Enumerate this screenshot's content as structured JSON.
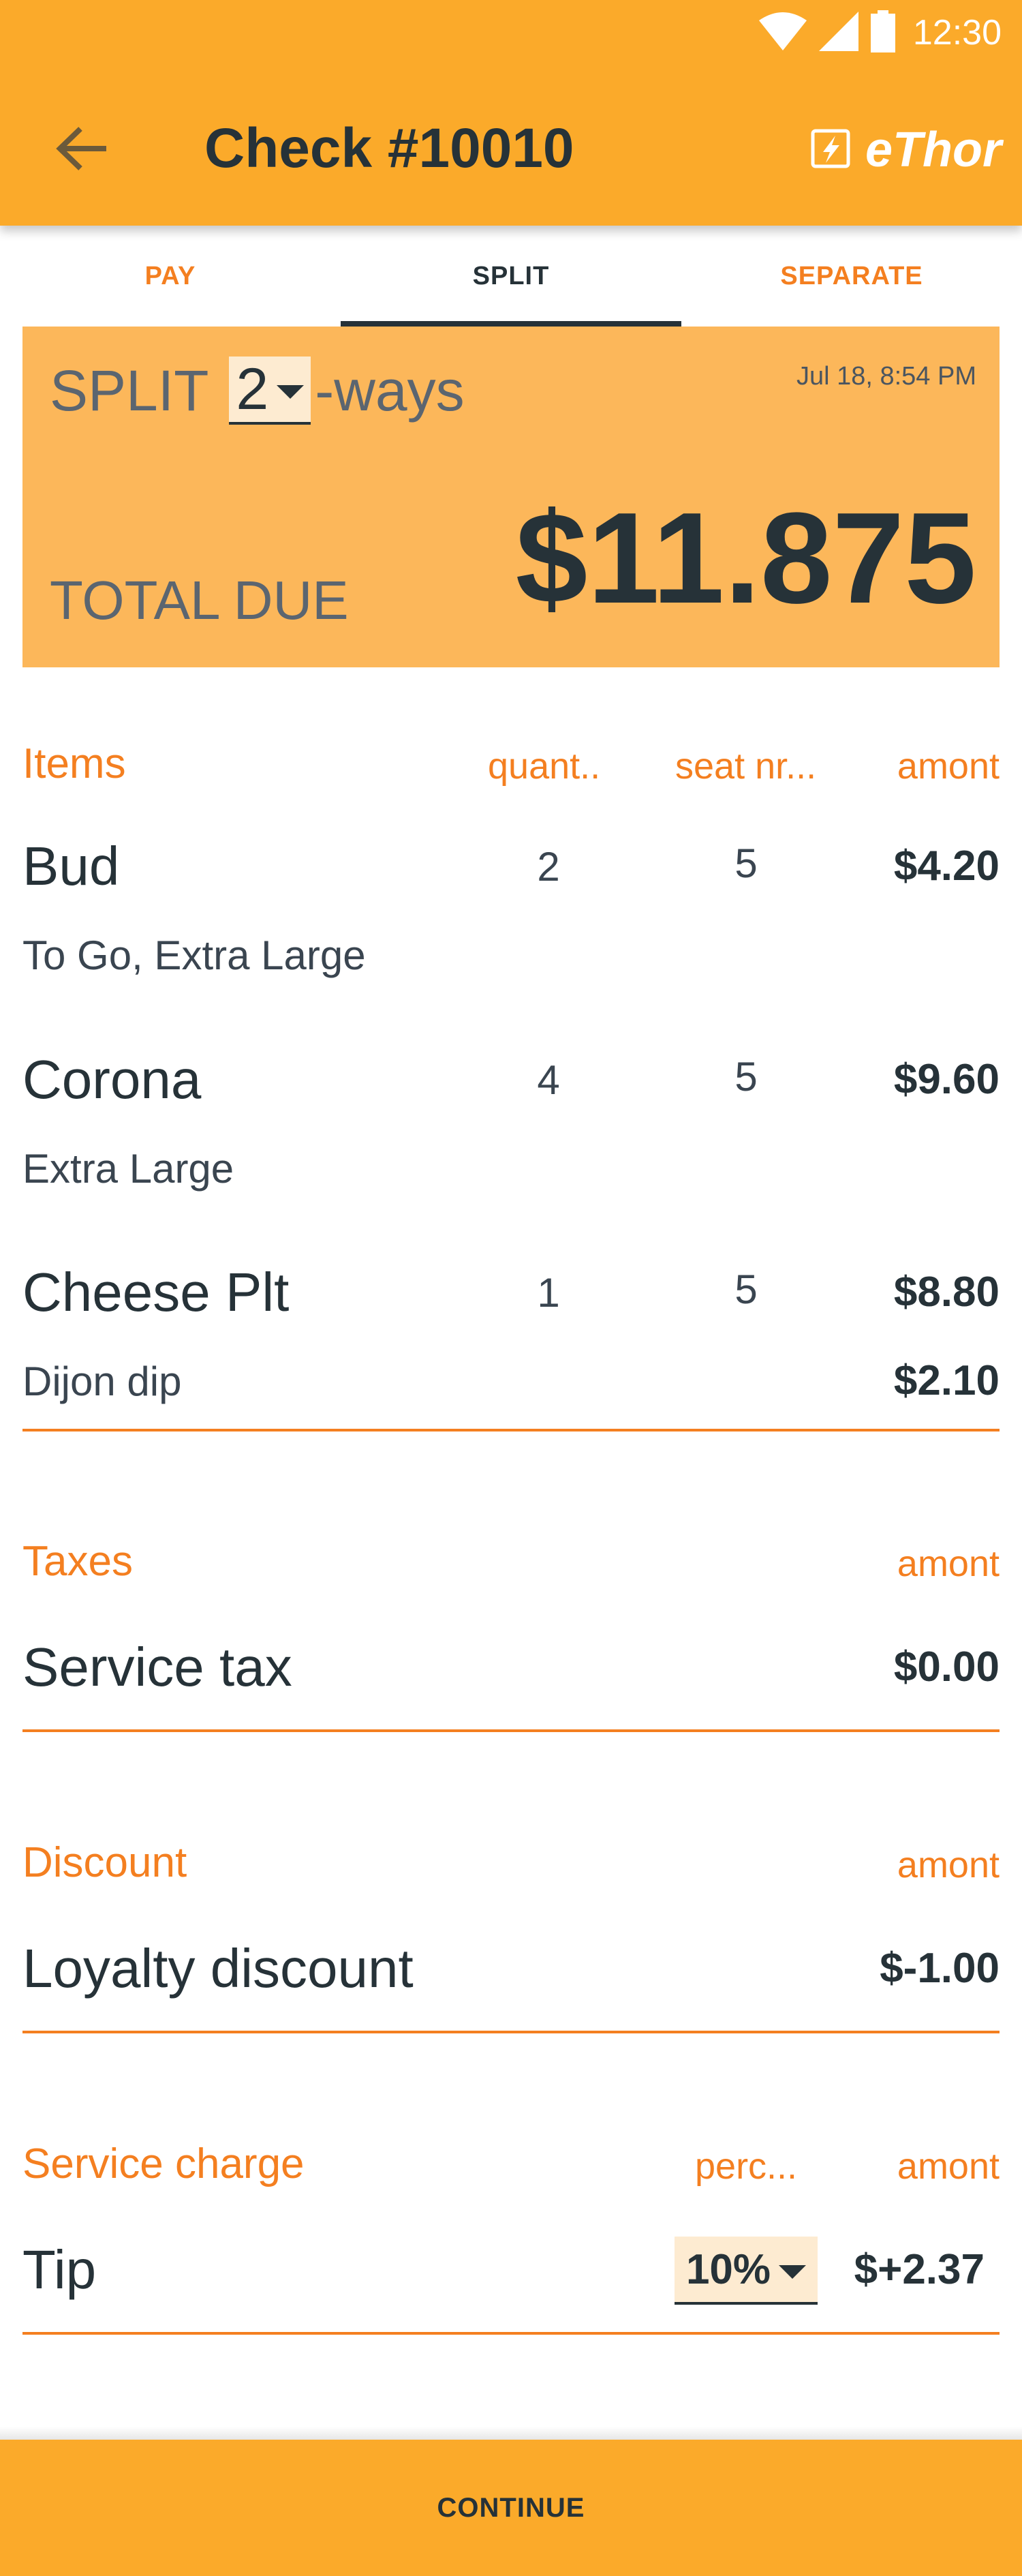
{
  "status_bar": {
    "time": "12:30",
    "icons": [
      "wifi-icon",
      "signal-icon",
      "battery-icon"
    ]
  },
  "app_bar": {
    "title": "Check #10010",
    "brand": "eThor",
    "back_icon": "arrow-left-icon",
    "brand_icon": "lightning-icon"
  },
  "tabs": [
    {
      "label": "PAY",
      "active": false
    },
    {
      "label": "SPLIT",
      "active": true
    },
    {
      "label": "SEPARATE",
      "active": false
    }
  ],
  "summary": {
    "split_prefix": "SPLIT",
    "split_value": "2",
    "split_suffix": "-ways",
    "date": "Jul 18, 8:54 PM",
    "total_label": "TOTAL DUE",
    "total_amount": "$11.875"
  },
  "items_section": {
    "label": "Items",
    "col_qty": "quant..",
    "col_seat": "seat nr...",
    "col_amount": "amont",
    "items": [
      {
        "name": "Bud",
        "qty": "2",
        "seat": "5",
        "amount": "$4.20",
        "modifier": "To Go, Extra Large",
        "modifier_amount": ""
      },
      {
        "name": "Corona",
        "qty": "4",
        "seat": "5",
        "amount": "$9.60",
        "modifier": "Extra Large",
        "modifier_amount": ""
      },
      {
        "name": "Cheese Plt",
        "qty": "1",
        "seat": "5",
        "amount": "$8.80",
        "modifier": "Dijon dip",
        "modifier_amount": "$2.10"
      }
    ]
  },
  "taxes_section": {
    "label": "Taxes",
    "col_amount": "amont",
    "rows": [
      {
        "name": "Service tax",
        "amount": "$0.00"
      }
    ]
  },
  "discount_section": {
    "label": "Discount",
    "col_amount": "amont",
    "rows": [
      {
        "name": "Loyalty discount",
        "amount": "$-1.00"
      }
    ]
  },
  "service_section": {
    "label": "Service charge",
    "col_percent": "perc...",
    "col_amount": "amont",
    "rows": [
      {
        "name": "Tip",
        "percent": "10%",
        "amount": "$+2.37"
      }
    ]
  },
  "continue_label": "CONTINUE",
  "colors": {
    "primary": "#FBAA2A",
    "accent": "#F47F20",
    "summary_bg": "#FCB75A",
    "dark_text": "#263238"
  }
}
